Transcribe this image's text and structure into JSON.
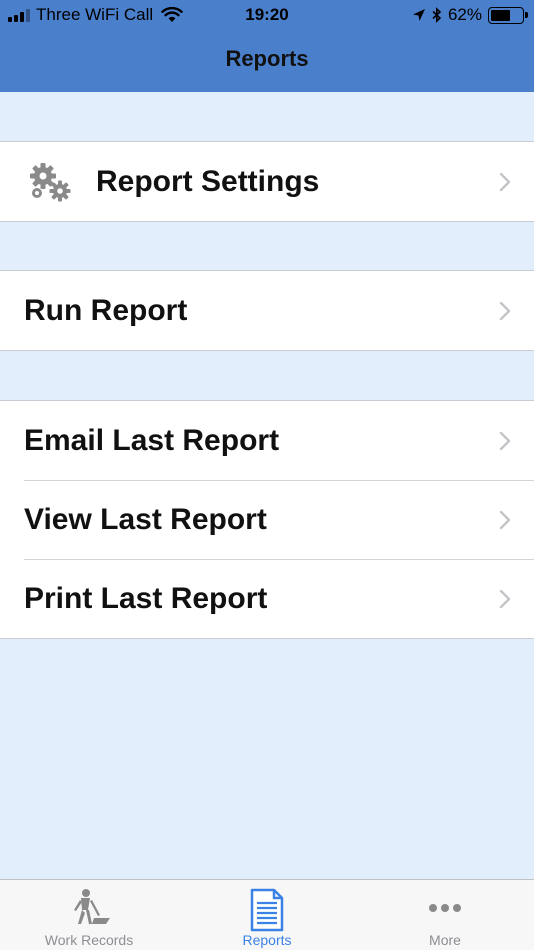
{
  "status_bar": {
    "carrier": "Three WiFi Call",
    "time": "19:20",
    "battery": "62%",
    "battery_level": 0.62
  },
  "nav": {
    "title": "Reports"
  },
  "groups": {
    "settings": {
      "label": "Report Settings",
      "icon": "gears-icon"
    },
    "run": {
      "label": "Run Report"
    },
    "last": {
      "email": "Email Last Report",
      "view": "View Last Report",
      "print": "Print Last Report"
    }
  },
  "tabs": {
    "work_records": {
      "label": "Work Records",
      "icon": "worker-shovel-icon"
    },
    "reports": {
      "label": "Reports",
      "icon": "document-icon",
      "active": true
    },
    "more": {
      "label": "More",
      "icon": "ellipsis-icon"
    }
  },
  "colors": {
    "header": "#4a7fcb",
    "background": "#e3eefc",
    "active_tab": "#3b82e6",
    "inactive_tab": "#8e8e93"
  }
}
